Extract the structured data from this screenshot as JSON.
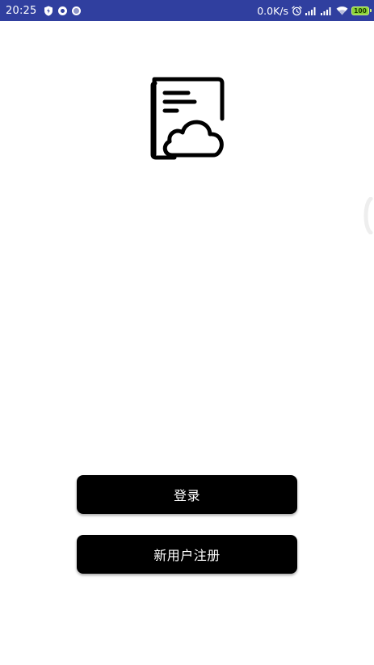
{
  "status_bar": {
    "time": "20:25",
    "network_speed": "0.0K/s",
    "battery_level": "100",
    "background_color": "#303f9f",
    "icons": [
      "shield-icon",
      "notification-dot-icon",
      "notification-dot-icon",
      "alarm-icon",
      "signal-icon",
      "signal-icon",
      "wifi-icon",
      "battery-icon"
    ]
  },
  "app": {
    "logo_icon": "document-cloud-icon"
  },
  "actions": {
    "login_label": "登录",
    "register_label": "新用户注册",
    "button_color": "#000000",
    "button_text_color": "#ffffff"
  }
}
